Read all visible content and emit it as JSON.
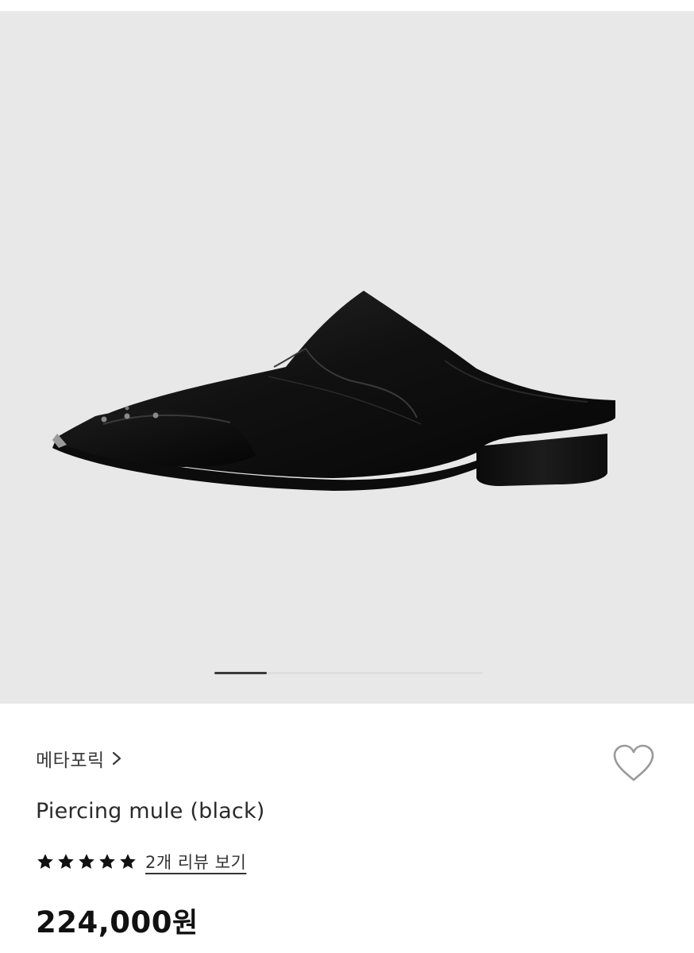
{
  "gallery": {
    "image_alt": "Piercing mule (black)",
    "total_images": 4,
    "current_index": 1,
    "background_color": "#e8e8e8"
  },
  "product": {
    "brand": "메타포릭",
    "brand_chevron": "chevron-right-icon",
    "name": "Piercing mule (black)",
    "rating": 5,
    "rating_max": 5,
    "reviews_link": "2개 리뷰 보기",
    "price": "224,000",
    "price_unit": "원",
    "wishlisted": false,
    "wishlist_icon": "heart-outline-icon"
  },
  "colors": {
    "text_primary": "#111111",
    "text_secondary": "#3a3a3a",
    "icon_gray": "#9a9a9a"
  }
}
